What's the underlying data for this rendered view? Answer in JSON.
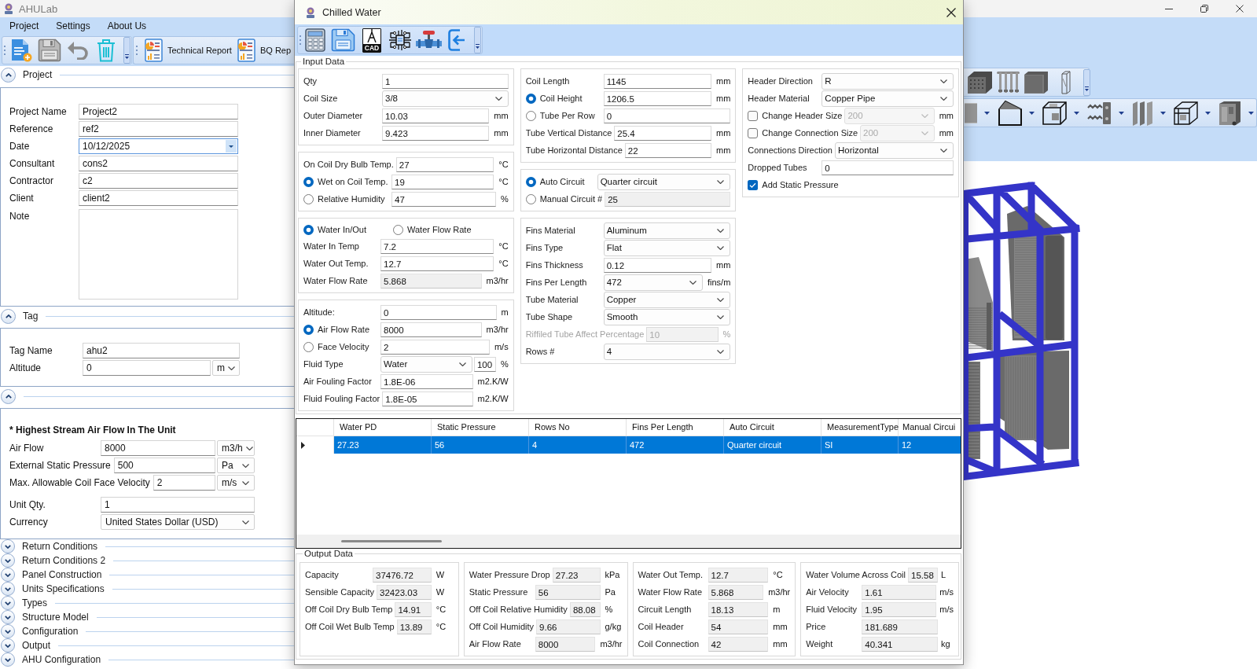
{
  "window": {
    "title": "AHULab"
  },
  "menu": [
    "Project",
    "Settings",
    "About Us"
  ],
  "toolbar": {
    "reports": [
      "Technical Report",
      "BQ Rep"
    ]
  },
  "sidebar": {
    "sections": [
      {
        "title": "Project",
        "expanded": true,
        "fields": [
          {
            "label": "Project Name",
            "value": "Project2",
            "kind": "text"
          },
          {
            "label": "Reference",
            "value": "ref2",
            "kind": "text"
          },
          {
            "label": "Date",
            "value": "10/12/2025",
            "kind": "date"
          },
          {
            "label": "Consultant",
            "value": "cons2",
            "kind": "text"
          },
          {
            "label": "Contractor",
            "value": "c2",
            "kind": "text"
          },
          {
            "label": "Client",
            "value": "client2",
            "kind": "text"
          },
          {
            "label": "Note",
            "kind": "memo"
          }
        ]
      },
      {
        "title": "Tag",
        "expanded": true,
        "fields": [
          {
            "label": "Tag Name",
            "value": "ahu2",
            "kind": "text"
          },
          {
            "label": "Altitude",
            "value": "0",
            "unit": "m",
            "kind": "text"
          }
        ]
      },
      {
        "expanded": true,
        "heading": "* Highest Stream Air Flow In The Unit",
        "fields": [
          {
            "label": "Air Flow",
            "value": "8000",
            "unit": "m3/h",
            "kind": "text"
          },
          {
            "label": "External Static Pressure",
            "value": "500",
            "unit": "Pa",
            "kind": "text"
          },
          {
            "label": "Max. Allowable Coil Face Velocity",
            "value": "2",
            "unit": "m/s",
            "kind": "text"
          },
          {
            "label": "Unit Qty.",
            "value": "1",
            "kind": "text"
          },
          {
            "label": "Currency",
            "value": "United States Dollar (USD)",
            "kind": "combo"
          }
        ]
      },
      {
        "title": "Return Conditions",
        "expanded": false
      },
      {
        "title": "Return Conditions 2",
        "expanded": false
      },
      {
        "title": "Panel Construction",
        "expanded": false
      },
      {
        "title": "Units Specifications",
        "expanded": false
      },
      {
        "title": "Types",
        "expanded": false
      },
      {
        "title": "Structure Model",
        "expanded": false
      },
      {
        "title": "Configuration",
        "expanded": false
      },
      {
        "title": "Output",
        "expanded": false
      },
      {
        "title": "AHU Configuration",
        "expanded": false
      }
    ]
  },
  "dialog": {
    "title": "Chilled Water",
    "toolbar": {
      "cad_label": "CAD"
    },
    "input_data": {
      "title": "Input Data",
      "columns": [
        {
          "panels": [
            {
              "rows": [
                {
                  "label": "Qty",
                  "value": "1",
                  "kind": "text"
                },
                {
                  "label": "Coil Size",
                  "value": "3/8",
                  "kind": "combo"
                },
                {
                  "label": "Outer Diameter",
                  "value": "10.03",
                  "unit": "mm",
                  "kind": "text"
                },
                {
                  "label": "Inner Diameter",
                  "value": "9.423",
                  "unit": "mm",
                  "kind": "text"
                }
              ]
            },
            {
              "rows": [
                {
                  "label": "On Coil Dry Bulb Temp.",
                  "value": "27",
                  "unit": "°C",
                  "kind": "text"
                },
                {
                  "label": "Wet on Coil Temp.",
                  "selected": true,
                  "value": "19",
                  "unit": "°C",
                  "kind": "text"
                },
                {
                  "label": "Relative Humidity",
                  "selected": false,
                  "value": "47",
                  "unit": "%",
                  "kind": "text"
                }
              ]
            },
            {
              "options": [
                {
                  "label": "Water In/Out",
                  "selected": true
                },
                {
                  "label": "Water Flow Rate",
                  "selected": false
                }
              ],
              "rows": [
                {
                  "label": "Water In Temp",
                  "value": "7.2",
                  "unit": "°C",
                  "kind": "text"
                },
                {
                  "label": "Water Out Temp.",
                  "value": "12.7",
                  "unit": "°C",
                  "kind": "text"
                },
                {
                  "label": "Water Flow Rate",
                  "value": "5.868",
                  "unit": "m3/hr",
                  "kind": "readonly"
                }
              ]
            },
            {
              "rows": [
                {
                  "label": "Altitude:",
                  "value": "0",
                  "unit": "m",
                  "kind": "text"
                },
                {
                  "label": "Air Flow Rate",
                  "selected": true,
                  "value": "8000",
                  "unit": "m3/hr",
                  "kind": "text"
                },
                {
                  "label": "Face Velocity",
                  "selected": false,
                  "value": "2",
                  "unit": "m/s",
                  "kind": "text"
                },
                {
                  "label": "Fluid Type",
                  "value": "Water",
                  "value_2": "100",
                  "unit": "%",
                  "kind": "combo_text"
                },
                {
                  "label": "Air Fouling Factor",
                  "value": "1.8E-06",
                  "unit": "m2.K/W",
                  "kind": "text"
                },
                {
                  "label": "Fluid Fouling Factor",
                  "value": "1.8E-05",
                  "unit": "m2.K/W",
                  "kind": "text"
                }
              ]
            }
          ]
        },
        {
          "panels": [
            {
              "rows": [
                {
                  "label": "Coil Length",
                  "value": "1145",
                  "unit": "mm",
                  "kind": "text"
                },
                {
                  "label": "Coil Height",
                  "selected": true,
                  "value": "1206.5",
                  "unit": "mm",
                  "kind": "text"
                },
                {
                  "label": "Tube Per Row",
                  "selected": false,
                  "value": "0",
                  "kind": "text"
                },
                {
                  "label": "Tube Vertical Distance",
                  "value": "25.4",
                  "unit": "mm",
                  "kind": "text"
                },
                {
                  "label": "Tube Horizontal Distance",
                  "value": "22",
                  "unit": "mm",
                  "kind": "text"
                }
              ]
            },
            {
              "rows": [
                {
                  "label": "Auto Circuit",
                  "selected": true,
                  "value": "Quarter circuit",
                  "kind": "combo"
                },
                {
                  "label": "Manual Circuit #",
                  "selected": false,
                  "value": "25",
                  "kind": "readonly"
                }
              ]
            },
            {
              "rows": [
                {
                  "label": "Fins Material",
                  "value": "Aluminum",
                  "kind": "combo"
                },
                {
                  "label": "Fins Type",
                  "value": "Flat",
                  "kind": "combo"
                },
                {
                  "label": "Fins Thickness",
                  "value": "0.12",
                  "unit": "mm",
                  "kind": "text"
                },
                {
                  "label": "Fins Per Length",
                  "value": "472",
                  "unit": "fins/m",
                  "kind": "combo"
                },
                {
                  "label": "Tube Material",
                  "value": "Copper",
                  "kind": "combo"
                },
                {
                  "label": "Tube Shape",
                  "value": "Smooth",
                  "kind": "combo"
                },
                {
                  "label": "Riffiled Tube Affect Percentage",
                  "value": "10",
                  "unit": "%",
                  "kind": "text",
                  "disabled": true
                },
                {
                  "label": "Rows #",
                  "value": "4",
                  "kind": "combo"
                }
              ]
            }
          ]
        },
        {
          "panels": [
            {
              "rows": [
                {
                  "label": "Header Direction",
                  "value": "R",
                  "kind": "combo"
                },
                {
                  "label": "Header Material",
                  "value": "Copper Pipe",
                  "kind": "combo"
                },
                {
                  "label": "Change Header Size",
                  "checked": false,
                  "value": "200",
                  "unit": "mm",
                  "kind": "combo",
                  "disabled": true
                },
                {
                  "label": "Change Connection Size",
                  "checked": false,
                  "value": "200",
                  "unit": "mm",
                  "kind": "combo",
                  "disabled": true
                },
                {
                  "label": "Connections Direction",
                  "value": "Horizontal",
                  "kind": "combo"
                },
                {
                  "label": "Dropped Tubes",
                  "value": "0",
                  "kind": "text"
                },
                {
                  "label": "Add Static Pressure",
                  "checked": true,
                  "kind": "none"
                }
              ]
            }
          ]
        }
      ]
    },
    "results_table": {
      "columns": [
        "Water PD",
        "Static Pressure",
        "Rows No",
        "Fins Per Length",
        "Auto Circuit",
        "MeasurementType",
        "Manual Circui"
      ],
      "rows": [
        {
          "selected": true,
          "cells": [
            "27.23",
            "56",
            "4",
            "472",
            "Quarter circuit",
            "SI",
            "12"
          ]
        }
      ]
    },
    "output_data": {
      "title": "Output Data",
      "panels": [
        {
          "rows": [
            {
              "label": "Capacity",
              "value": "37476.72",
              "unit": "W"
            },
            {
              "label": "Sensible Capacity",
              "value": "32423.03",
              "unit": "W"
            },
            {
              "label": "Off Coil Dry Bulb Temp",
              "value": "14.91",
              "unit": "°C"
            },
            {
              "label": "Off Coil Wet Bulb Temp",
              "value": "13.89",
              "unit": "°C"
            }
          ]
        },
        {
          "rows": [
            {
              "label": "Water Pressure Drop",
              "value": "27.23",
              "unit": "kPa"
            },
            {
              "label": "Static Pressure",
              "value": "56",
              "unit": "Pa"
            },
            {
              "label": "Off Coil Relative Humidity",
              "value": "88.08",
              "unit": "%"
            },
            {
              "label": "Off Coil Humidity",
              "value": "9.66",
              "unit": "g/kg"
            },
            {
              "label": "Air Flow Rate",
              "value": "8000",
              "unit": "m3/hr"
            }
          ]
        },
        {
          "rows": [
            {
              "label": "Water Out Temp.",
              "value": "12.7",
              "unit": "°C"
            },
            {
              "label": "Water Flow Rate",
              "value": "5.868",
              "unit": "m3/hr"
            },
            {
              "label": "Circuit Length",
              "value": "18.13",
              "unit": "m"
            },
            {
              "label": "Coil Header",
              "value": "54",
              "unit": "mm"
            },
            {
              "label": "Coil Connection",
              "value": "42",
              "unit": "mm"
            }
          ]
        },
        {
          "rows": [
            {
              "label": "Water Volume Across Coil",
              "value": "15.58",
              "unit": "L"
            },
            {
              "label": "Air Velocity",
              "value": "1.61",
              "unit": "m/s"
            },
            {
              "label": "Fluid Velocity",
              "value": "1.95",
              "unit": "m/s"
            },
            {
              "label": "Price",
              "value": "181.689"
            },
            {
              "label": "Weight",
              "value": "40.341",
              "unit": "kg"
            }
          ]
        }
      ]
    }
  }
}
